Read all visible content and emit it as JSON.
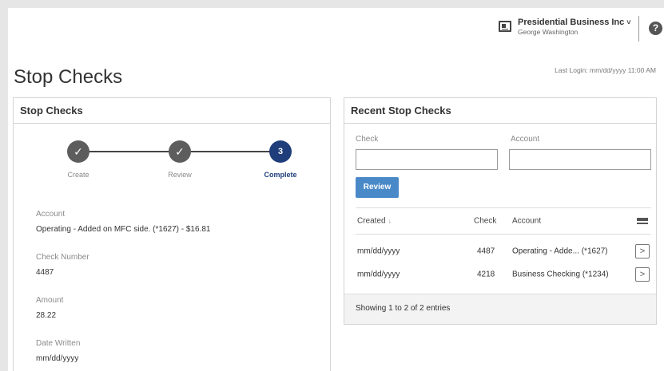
{
  "header": {
    "company_name": "Presidential Business Inc",
    "caret": "˅",
    "user_name": "George Washington",
    "help_label": "?"
  },
  "page": {
    "title": "Stop Checks",
    "last_login": "Last Login: mm/dd/yyyy 11:00 AM"
  },
  "left_panel": {
    "title": "Stop Checks",
    "steps": [
      {
        "label": "Create",
        "state": "done",
        "glyph": "✓"
      },
      {
        "label": "Review",
        "state": "done",
        "glyph": "✓"
      },
      {
        "label": "Complete",
        "state": "active",
        "glyph": "3"
      }
    ],
    "fields": [
      {
        "label": "Account",
        "value": "Operating - Added on MFC side.  (*1627) - $16.81"
      },
      {
        "label": "Check Number",
        "value": "4487"
      },
      {
        "label": "Amount",
        "value": "28.22"
      },
      {
        "label": "Date Written",
        "value": "mm/dd/yyyy"
      }
    ]
  },
  "right_panel": {
    "title": "Recent Stop Checks",
    "check_label": "Check",
    "account_label": "Account",
    "check_value": "",
    "account_value": "",
    "review_button": "Review",
    "table": {
      "headers": {
        "created": "Created",
        "sort_glyph": "↓",
        "check": "Check",
        "account": "Account"
      },
      "rows": [
        {
          "created": "mm/dd/yyyy",
          "check": "4487",
          "account": "Operating - Adde... (*1627)",
          "action": ">"
        },
        {
          "created": "mm/dd/yyyy",
          "check": "4218",
          "account": "Business Checking (*1234)",
          "action": ">"
        }
      ]
    },
    "footer": "Showing 1 to 2 of 2 entries"
  },
  "colors": {
    "accent": "#1f3d7a",
    "button": "#4a89c8",
    "step_done": "#5d5d5d"
  }
}
